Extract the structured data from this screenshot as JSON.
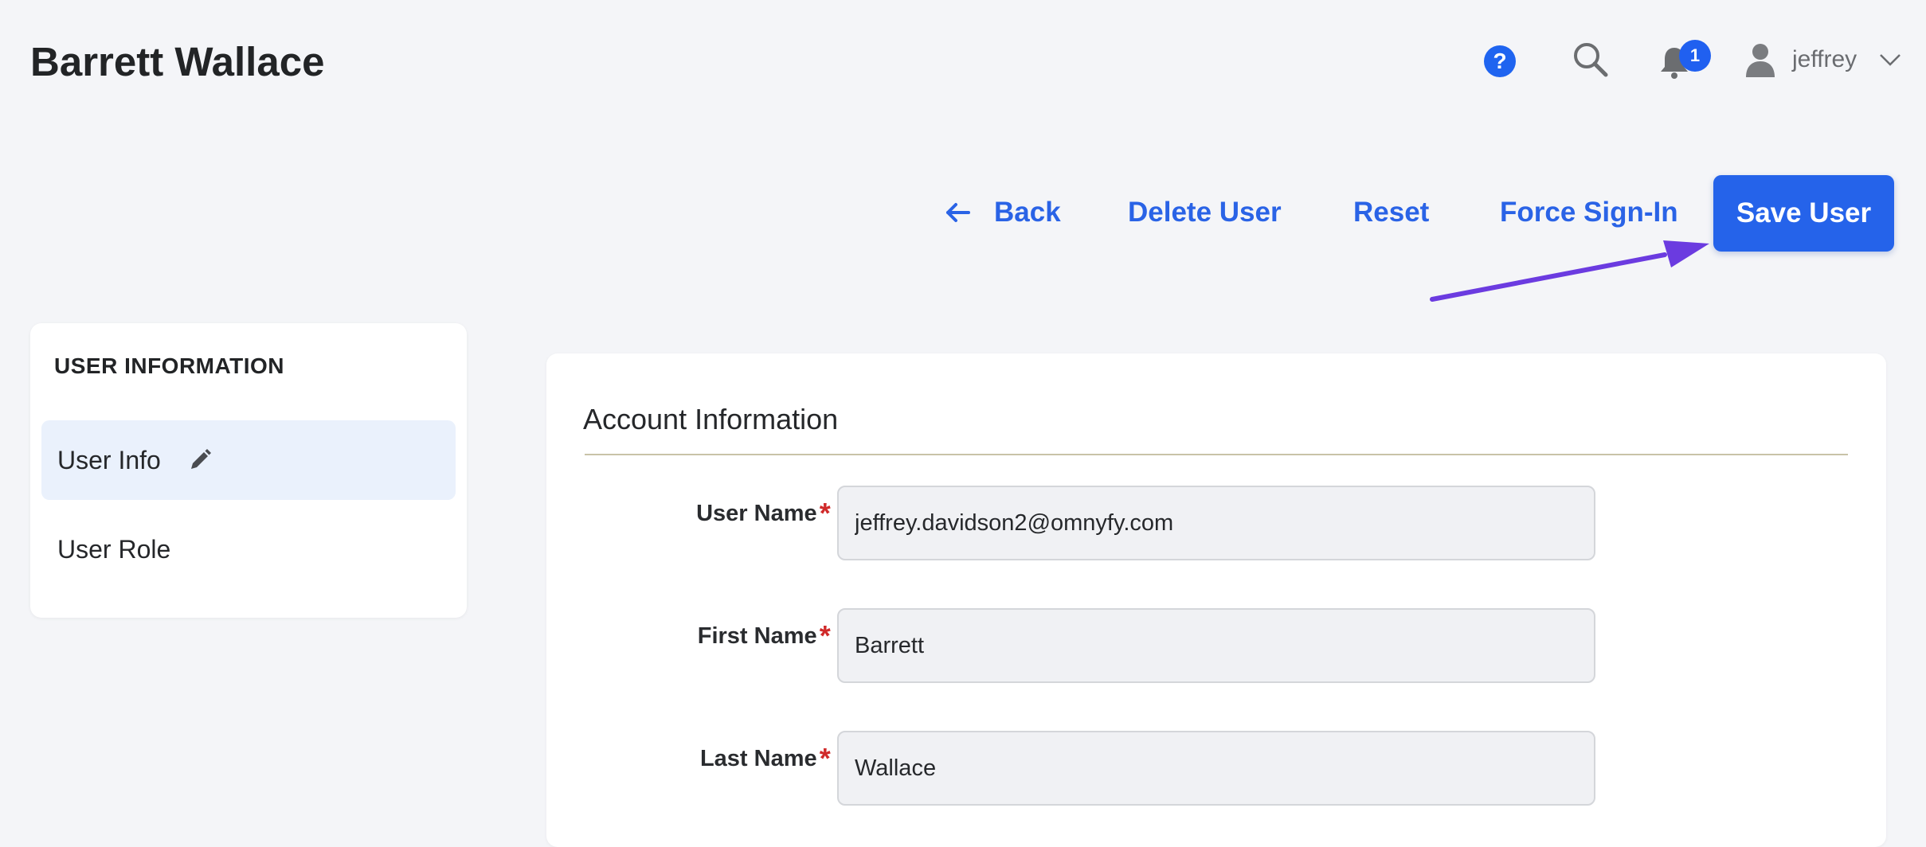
{
  "header": {
    "title": "Barrett Wallace",
    "help_icon": "question-circle-icon",
    "help_glyph": "?",
    "search_icon": "search-icon",
    "notifications": {
      "icon": "bell-icon",
      "count": "1"
    },
    "user": {
      "avatar_icon": "user-avatar-icon",
      "name": "jeffrey",
      "menu_icon": "chevron-down-icon"
    }
  },
  "actions": {
    "back_label": "Back",
    "back_icon": "arrow-left-icon",
    "delete_label": "Delete User",
    "reset_label": "Reset",
    "force_signin_label": "Force Sign-In",
    "save_label": "Save User"
  },
  "sidebar": {
    "heading": "USER INFORMATION",
    "items": [
      {
        "label": "User Info",
        "active": true,
        "icon": "pencil-icon"
      },
      {
        "label": "User Role",
        "active": false
      }
    ]
  },
  "account": {
    "section_title": "Account Information",
    "required_marker": "*",
    "fields": [
      {
        "label": "User Name",
        "value": "jeffrey.davidson2@omnyfy.com"
      },
      {
        "label": "First Name",
        "value": "Barrett"
      },
      {
        "label": "Last Name",
        "value": "Wallace"
      }
    ]
  },
  "colors": {
    "accent": "#2563ea",
    "background": "#f4f5f8",
    "required": "#d02a2a",
    "annotation_arrow": "#6b3be0"
  }
}
